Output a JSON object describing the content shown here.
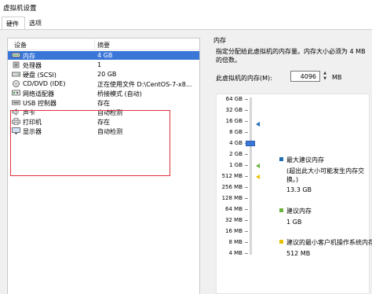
{
  "window": {
    "title": "虚拟机设置"
  },
  "tabs": [
    {
      "label": "硬件",
      "active": true
    },
    {
      "label": "选项",
      "active": false
    }
  ],
  "device_list": {
    "headers": {
      "device": "设备",
      "summary": "摘要"
    },
    "rows": [
      {
        "name": "内存",
        "summary": "4 GB",
        "icon": "memory-icon",
        "selected": true
      },
      {
        "name": "处理器",
        "summary": "1",
        "icon": "cpu-icon",
        "selected": false
      },
      {
        "name": "硬盘 (SCSI)",
        "summary": "20 GB",
        "icon": "hard-disk-icon",
        "selected": false
      },
      {
        "name": "CD/DVD (IDE)",
        "summary": "正在使用文件 D:\\CentOS-7-x8...",
        "icon": "cd-dvd-icon",
        "selected": false
      },
      {
        "name": "网络适配器",
        "summary": "桥接模式 (自动)",
        "icon": "network-adapter-icon",
        "selected": false
      },
      {
        "name": "USB 控制器",
        "summary": "存在",
        "icon": "usb-icon",
        "selected": false
      },
      {
        "name": "声卡",
        "summary": "自动检测",
        "icon": "sound-card-icon",
        "selected": false
      },
      {
        "name": "打印机",
        "summary": "存在",
        "icon": "printer-icon",
        "selected": false
      },
      {
        "name": "显示器",
        "summary": "自动检测",
        "icon": "monitor-icon",
        "selected": false
      }
    ]
  },
  "memory_panel": {
    "title": "内存",
    "description": "指定分配给此虚拟机的内存量。内存大小必须为 4 MB 的倍数。",
    "field_label": "此虚拟机的内存(M):",
    "value": "4096",
    "unit": "MB",
    "scale_labels": [
      "64 GB",
      "32 GB",
      "16 GB",
      "8 GB",
      "4 GB",
      "2 GB",
      "1 GB",
      "512 MB",
      "256 MB",
      "128 MB",
      "64 MB",
      "32 MB",
      "16 MB",
      "8 MB",
      "4 MB"
    ],
    "current_label": "4 GB",
    "legend": {
      "max": {
        "label": "最大建议内存",
        "note": "(超出此大小可能发生内存交换。)",
        "value": "13.3 GB",
        "color": "#1f6fb5"
      },
      "recommended": {
        "label": "建议内存",
        "value": "1 GB",
        "color": "#6cb33e"
      },
      "guest_min": {
        "label": "建议的最小客户机操作系统内存",
        "value": "512 MB",
        "color": "#e8c000"
      }
    }
  },
  "colors": {
    "selection": "#3a76d8",
    "highlight_box": "#e0303a"
  }
}
